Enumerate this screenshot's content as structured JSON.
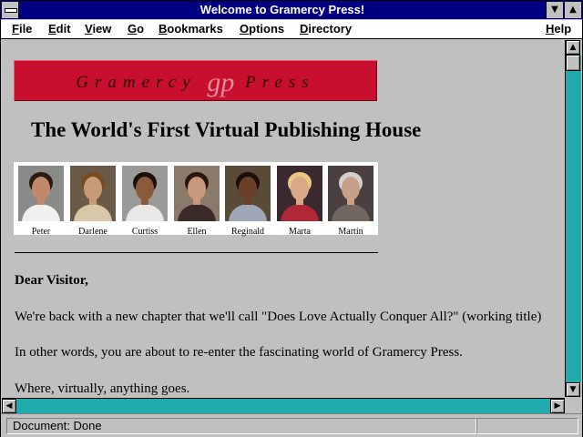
{
  "window": {
    "title": "Welcome to Gramercy Press!",
    "minimize_glyph": "▼",
    "maximize_glyph": "▲"
  },
  "menu": [
    {
      "accel": "F",
      "rest": "ile"
    },
    {
      "accel": "E",
      "rest": "dit"
    },
    {
      "accel": "V",
      "rest": "iew"
    },
    {
      "accel": "G",
      "rest": "o"
    },
    {
      "accel": "B",
      "rest": "ookmarks"
    },
    {
      "accel": "O",
      "rest": "ptions"
    },
    {
      "accel": "D",
      "rest": "irectory"
    },
    {
      "accel": "H",
      "rest": "elp"
    }
  ],
  "banner": {
    "left": "Gramercy",
    "monogram": "gp",
    "right": "Press"
  },
  "headline": "The World's First Virtual Publishing House",
  "people": [
    {
      "name": "Peter",
      "bg": "#8a8a88",
      "skin": "#c08a6a",
      "hair": "#2a1a10",
      "shirt": "#f0f0f0"
    },
    {
      "name": "Darlene",
      "bg": "#6a5a48",
      "skin": "#c89a78",
      "hair": "#7a4a20",
      "shirt": "#d8c8a8"
    },
    {
      "name": "Curtiss",
      "bg": "#9a9a98",
      "skin": "#8a5a3a",
      "hair": "#1a1008",
      "shirt": "#e8e8e8"
    },
    {
      "name": "Ellen",
      "bg": "#8a7a6a",
      "skin": "#c8987a",
      "hair": "#2a1810",
      "shirt": "#3a2a28"
    },
    {
      "name": "Reginald",
      "bg": "#5a4a38",
      "skin": "#6a4028",
      "hair": "#1a1008",
      "shirt": "#a0a8b8"
    },
    {
      "name": "Marta",
      "bg": "#3a2a30",
      "skin": "#d8a888",
      "hair": "#e8c880",
      "shirt": "#b02838"
    },
    {
      "name": "Martin",
      "bg": "#4a4040",
      "skin": "#c8a088",
      "hair": "#d0d0d0",
      "shirt": "#706860"
    }
  ],
  "letter": {
    "greeting": "Dear Visitor,",
    "p1": "We're back with a new chapter that we'll call \"Does Love Actually Conquer All?\" (working title)",
    "p2": "In other words, you are about to re-enter the fascinating world of Gramercy Press.",
    "p3": "Where, virtually, anything goes."
  },
  "scroll": {
    "up": "▲",
    "down": "▼",
    "left": "◀",
    "right": "▶"
  },
  "status": {
    "text": "Document: Done"
  },
  "colors": {
    "titlebar": "#000080",
    "banner": "#c8102e",
    "scroll_track": "#00a0a0",
    "page_bg": "#c0c0c0"
  }
}
